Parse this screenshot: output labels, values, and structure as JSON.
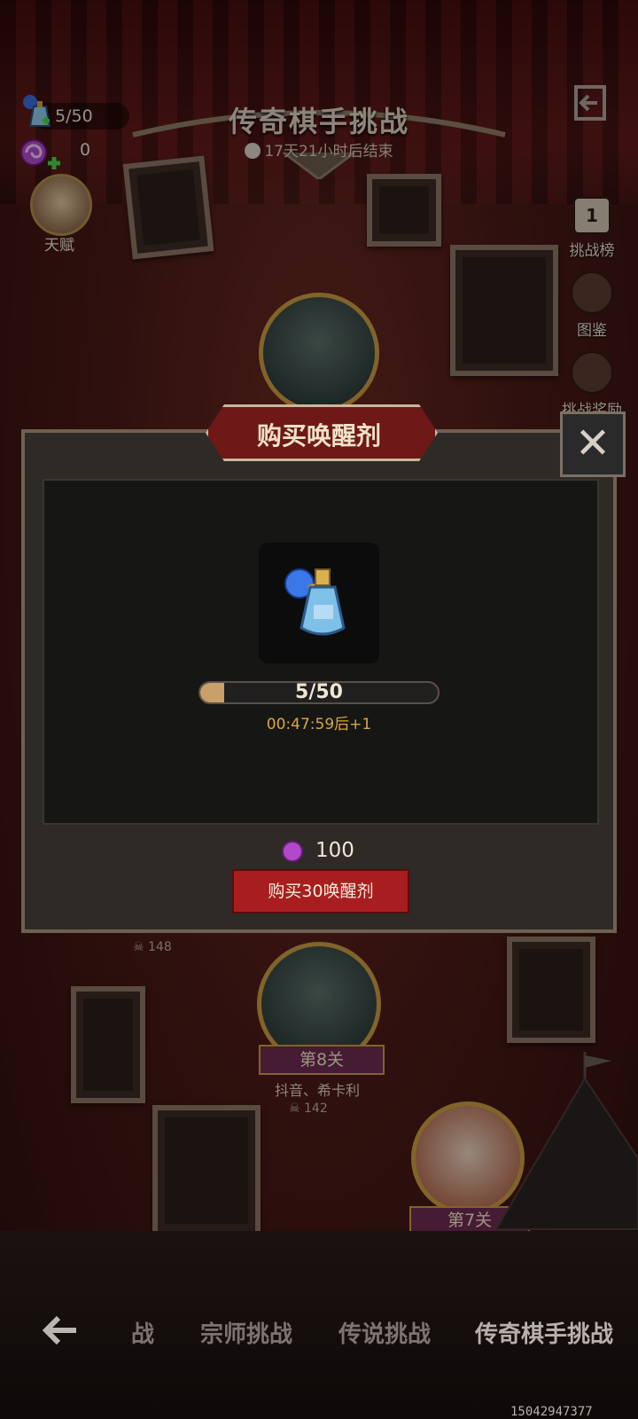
{
  "hud": {
    "elixir_count": "5/50",
    "candy_count": "0",
    "talent_label": "天赋"
  },
  "header": {
    "title": "传奇棋手挑战",
    "timer": "17天21小时后结束"
  },
  "side_menu": {
    "leaderboard_badge": "1",
    "leaderboard": "挑战榜",
    "codex": "图鉴",
    "rewards": "挑战奖励"
  },
  "dialog": {
    "title": "购买唤醒剂",
    "progress_text": "5/50",
    "progress_fraction": 0.1,
    "regen_text": "00:47:59后+1",
    "price": "100",
    "buy_label": "购买30唤醒剂"
  },
  "stages": {
    "stage8_label": "第8关",
    "stage8_sub": "抖音、希卡利",
    "stage8_skulls": "142",
    "stage_prev_skulls": "148",
    "stage7_label": "第7关"
  },
  "bottom_nav": {
    "tabs": [
      "战",
      "宗师挑战",
      "传说挑战",
      "传奇棋手挑战"
    ]
  },
  "footer": {
    "serial": "15042947377"
  }
}
